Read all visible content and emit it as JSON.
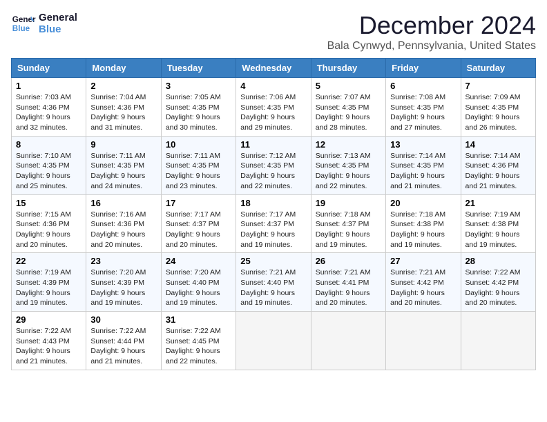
{
  "logo": {
    "line1": "General",
    "line2": "Blue"
  },
  "title": "December 2024",
  "subtitle": "Bala Cynwyd, Pennsylvania, United States",
  "headers": [
    "Sunday",
    "Monday",
    "Tuesday",
    "Wednesday",
    "Thursday",
    "Friday",
    "Saturday"
  ],
  "weeks": [
    [
      {
        "day": "1",
        "info": "Sunrise: 7:03 AM\nSunset: 4:36 PM\nDaylight: 9 hours\nand 32 minutes."
      },
      {
        "day": "2",
        "info": "Sunrise: 7:04 AM\nSunset: 4:36 PM\nDaylight: 9 hours\nand 31 minutes."
      },
      {
        "day": "3",
        "info": "Sunrise: 7:05 AM\nSunset: 4:35 PM\nDaylight: 9 hours\nand 30 minutes."
      },
      {
        "day": "4",
        "info": "Sunrise: 7:06 AM\nSunset: 4:35 PM\nDaylight: 9 hours\nand 29 minutes."
      },
      {
        "day": "5",
        "info": "Sunrise: 7:07 AM\nSunset: 4:35 PM\nDaylight: 9 hours\nand 28 minutes."
      },
      {
        "day": "6",
        "info": "Sunrise: 7:08 AM\nSunset: 4:35 PM\nDaylight: 9 hours\nand 27 minutes."
      },
      {
        "day": "7",
        "info": "Sunrise: 7:09 AM\nSunset: 4:35 PM\nDaylight: 9 hours\nand 26 minutes."
      }
    ],
    [
      {
        "day": "8",
        "info": "Sunrise: 7:10 AM\nSunset: 4:35 PM\nDaylight: 9 hours\nand 25 minutes."
      },
      {
        "day": "9",
        "info": "Sunrise: 7:11 AM\nSunset: 4:35 PM\nDaylight: 9 hours\nand 24 minutes."
      },
      {
        "day": "10",
        "info": "Sunrise: 7:11 AM\nSunset: 4:35 PM\nDaylight: 9 hours\nand 23 minutes."
      },
      {
        "day": "11",
        "info": "Sunrise: 7:12 AM\nSunset: 4:35 PM\nDaylight: 9 hours\nand 22 minutes."
      },
      {
        "day": "12",
        "info": "Sunrise: 7:13 AM\nSunset: 4:35 PM\nDaylight: 9 hours\nand 22 minutes."
      },
      {
        "day": "13",
        "info": "Sunrise: 7:14 AM\nSunset: 4:35 PM\nDaylight: 9 hours\nand 21 minutes."
      },
      {
        "day": "14",
        "info": "Sunrise: 7:14 AM\nSunset: 4:36 PM\nDaylight: 9 hours\nand 21 minutes."
      }
    ],
    [
      {
        "day": "15",
        "info": "Sunrise: 7:15 AM\nSunset: 4:36 PM\nDaylight: 9 hours\nand 20 minutes."
      },
      {
        "day": "16",
        "info": "Sunrise: 7:16 AM\nSunset: 4:36 PM\nDaylight: 9 hours\nand 20 minutes."
      },
      {
        "day": "17",
        "info": "Sunrise: 7:17 AM\nSunset: 4:37 PM\nDaylight: 9 hours\nand 20 minutes."
      },
      {
        "day": "18",
        "info": "Sunrise: 7:17 AM\nSunset: 4:37 PM\nDaylight: 9 hours\nand 19 minutes."
      },
      {
        "day": "19",
        "info": "Sunrise: 7:18 AM\nSunset: 4:37 PM\nDaylight: 9 hours\nand 19 minutes."
      },
      {
        "day": "20",
        "info": "Sunrise: 7:18 AM\nSunset: 4:38 PM\nDaylight: 9 hours\nand 19 minutes."
      },
      {
        "day": "21",
        "info": "Sunrise: 7:19 AM\nSunset: 4:38 PM\nDaylight: 9 hours\nand 19 minutes."
      }
    ],
    [
      {
        "day": "22",
        "info": "Sunrise: 7:19 AM\nSunset: 4:39 PM\nDaylight: 9 hours\nand 19 minutes."
      },
      {
        "day": "23",
        "info": "Sunrise: 7:20 AM\nSunset: 4:39 PM\nDaylight: 9 hours\nand 19 minutes."
      },
      {
        "day": "24",
        "info": "Sunrise: 7:20 AM\nSunset: 4:40 PM\nDaylight: 9 hours\nand 19 minutes."
      },
      {
        "day": "25",
        "info": "Sunrise: 7:21 AM\nSunset: 4:40 PM\nDaylight: 9 hours\nand 19 minutes."
      },
      {
        "day": "26",
        "info": "Sunrise: 7:21 AM\nSunset: 4:41 PM\nDaylight: 9 hours\nand 20 minutes."
      },
      {
        "day": "27",
        "info": "Sunrise: 7:21 AM\nSunset: 4:42 PM\nDaylight: 9 hours\nand 20 minutes."
      },
      {
        "day": "28",
        "info": "Sunrise: 7:22 AM\nSunset: 4:42 PM\nDaylight: 9 hours\nand 20 minutes."
      }
    ],
    [
      {
        "day": "29",
        "info": "Sunrise: 7:22 AM\nSunset: 4:43 PM\nDaylight: 9 hours\nand 21 minutes."
      },
      {
        "day": "30",
        "info": "Sunrise: 7:22 AM\nSunset: 4:44 PM\nDaylight: 9 hours\nand 21 minutes."
      },
      {
        "day": "31",
        "info": "Sunrise: 7:22 AM\nSunset: 4:45 PM\nDaylight: 9 hours\nand 22 minutes."
      },
      {
        "day": "",
        "info": ""
      },
      {
        "day": "",
        "info": ""
      },
      {
        "day": "",
        "info": ""
      },
      {
        "day": "",
        "info": ""
      }
    ]
  ]
}
